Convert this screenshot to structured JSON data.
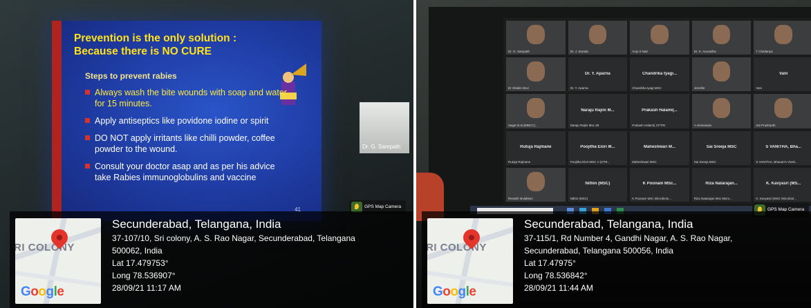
{
  "left": {
    "slide": {
      "title": "Prevention is the only solution :\nBecause there is NO CURE",
      "subtitle": "Steps to prevent rabies",
      "bullets": [
        "Always wash the  bite wounds with soap and water for 15 minutes.",
        "Apply antiseptics like povidone iodine or spirit",
        "DO NOT apply irritants  like chilli powder, coffee powder  to the wound.",
        "Consult your doctor asap and as per his advice take Rabies immunoglobulins and vaccine"
      ],
      "page_number": "41"
    },
    "camera_label": "Dr. G. Sampath",
    "gps": {
      "badge": "GPS Map Camera",
      "map_label": "RI COLONY",
      "google": [
        "G",
        "o",
        "o",
        "g",
        "l",
        "e"
      ],
      "city": "Secunderabad, Telangana, India",
      "address_lines": [
        "37-107/10, Sri colony, A. S. Rao Nagar, Secunderabad, Telangana",
        "500062, India"
      ],
      "lat": "Lat 17.479753°",
      "long": "Long 78.536907°",
      "datetime": "28/09/21 11:17 AM"
    }
  },
  "right": {
    "participants": [
      {
        "name": "",
        "label": "Dr. G. Sampath"
      },
      {
        "name": "",
        "label": "Dr. J. Sarada"
      },
      {
        "name": "",
        "label": "Anju S Nair"
      },
      {
        "name": "",
        "label": "Dr. K. Anuradha"
      },
      {
        "name": "",
        "label": "T Chaitanya"
      },
      {
        "name": "",
        "label": "Dr Shalini Devi"
      },
      {
        "name": "Dr. Y. Aparna",
        "label": "Dr. Y. Aparna"
      },
      {
        "name": "Chandrika tyagi...",
        "label": "Chandrika tyagi MSC"
      },
      {
        "name": "",
        "label": "Jennifer"
      },
      {
        "name": "Vani",
        "label": "Vani"
      },
      {
        "name": "",
        "label": "Sagar B.Sc(MBCC)..."
      },
      {
        "name": "Naraju Rajini M...",
        "label": "Naraju Rajini Msc 28"
      },
      {
        "name": "Prakash Halami(...",
        "label": "Prakash Halami( CFTRI"
      },
      {
        "name": "",
        "label": "A srinivasulu"
      },
      {
        "name": "",
        "label": "Sai Prashanth"
      },
      {
        "name": "Rutuja Rajmane",
        "label": "Rutuja Rajmane"
      },
      {
        "name": "Poojitha Elori M...",
        "label": "Poojitha Elori MSC V (OTE..."
      },
      {
        "name": "Maheshwari M...",
        "label": "Maheshwari MSC"
      },
      {
        "name": "Sai Sreeja MSC",
        "label": "Sai Sreeja MSC"
      },
      {
        "name": "S VANITHA, Bha...",
        "label": "S VANITHA, Bhavan's Vivek..."
      },
      {
        "name": "",
        "label": "Revathi Mulakken"
      },
      {
        "name": "Nithin (MSC)",
        "label": "Nithin (MSC)"
      },
      {
        "name": "K Poonam MSc...",
        "label": "K Poonam MSc Microbiolo..."
      },
      {
        "name": "Riza Natarajan...",
        "label": "Riza Natarajan Msc Micro..."
      },
      {
        "name": "K. Kavyasri (MS...",
        "label": "K. Kavyasri (MSC Microbiol..."
      }
    ],
    "gps": {
      "badge": "GPS Map Camera",
      "map_label": "RI COLONY",
      "google": [
        "G",
        "o",
        "o",
        "g",
        "l",
        "e"
      ],
      "city": "Secunderabad, Telangana, India",
      "address_lines": [
        "37-115/1, Rd Number 4, Gandhi Nagar, A. S. Rao Nagar,",
        "Secunderabad, Telangana 500056, India"
      ],
      "lat": "Lat 17.47975°",
      "long": "Long 78.536842°",
      "datetime": "28/09/21 11:44 AM"
    }
  },
  "colors": {
    "slide_bg": "#1e3aa0",
    "slide_title": "#ffe21a",
    "bullet_marker": "#d8322c",
    "pin": "#e4352c"
  }
}
